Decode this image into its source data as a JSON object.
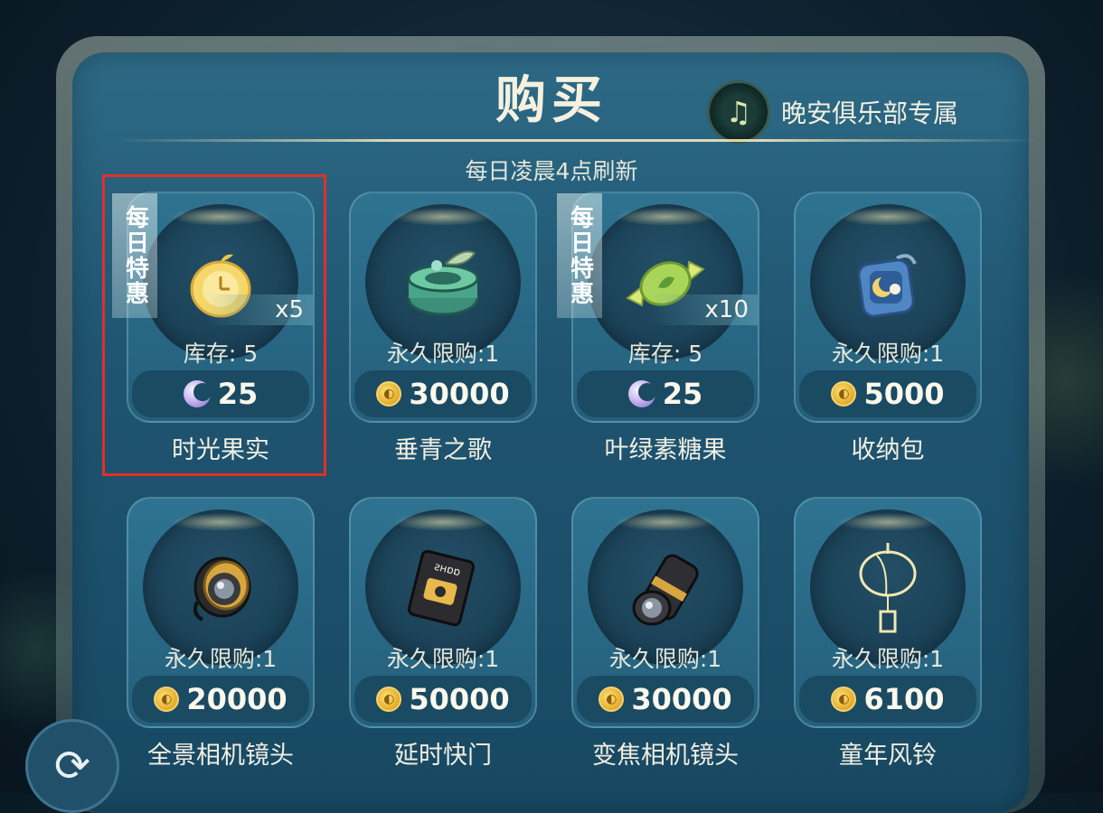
{
  "header": {
    "title": "购买",
    "club_label": "晚安俱乐部专属",
    "club_icon": "music-note-icon",
    "refresh_note": "每日凌晨4点刷新"
  },
  "shop": {
    "items": [
      {
        "name": "时光果实",
        "icon": "clock-fruit-icon",
        "limit": "库存: 5",
        "qty": "x5",
        "deal": "每日特惠",
        "currency": "moon",
        "price": "25",
        "selected": true
      },
      {
        "name": "垂青之歌",
        "icon": "music-box-icon",
        "limit": "永久限购:1",
        "qty": "",
        "deal": "",
        "currency": "coin",
        "price": "30000",
        "selected": false
      },
      {
        "name": "叶绿素糖果",
        "icon": "leaf-candy-icon",
        "limit": "库存: 5",
        "qty": "x10",
        "deal": "每日特惠",
        "currency": "moon",
        "price": "25",
        "selected": false
      },
      {
        "name": "收纳包",
        "icon": "storage-bag-icon",
        "limit": "永久限购:1",
        "qty": "",
        "deal": "",
        "currency": "coin",
        "price": "5000",
        "selected": false
      },
      {
        "name": "全景相机镜头",
        "icon": "panorama-lens-icon",
        "limit": "永久限购:1",
        "qty": "",
        "deal": "",
        "currency": "coin",
        "price": "20000",
        "selected": false
      },
      {
        "name": "延时快门",
        "icon": "timelapse-book-icon",
        "limit": "永久限购:1",
        "qty": "",
        "deal": "",
        "currency": "coin",
        "price": "50000",
        "selected": false
      },
      {
        "name": "变焦相机镜头",
        "icon": "zoom-lens-icon",
        "limit": "永久限购:1",
        "qty": "",
        "deal": "",
        "currency": "coin",
        "price": "30000",
        "selected": false
      },
      {
        "name": "童年风铃",
        "icon": "wind-chime-icon",
        "limit": "永久限购:1",
        "qty": "",
        "deal": "",
        "currency": "coin",
        "price": "6100",
        "selected": false
      }
    ]
  },
  "controls": {
    "refresh_icon": "refresh-icon"
  },
  "colors": {
    "panel": "#245f7b",
    "highlight": "#e0302a",
    "coin": "#e3aa2a",
    "moon": "#c8b5f0"
  }
}
